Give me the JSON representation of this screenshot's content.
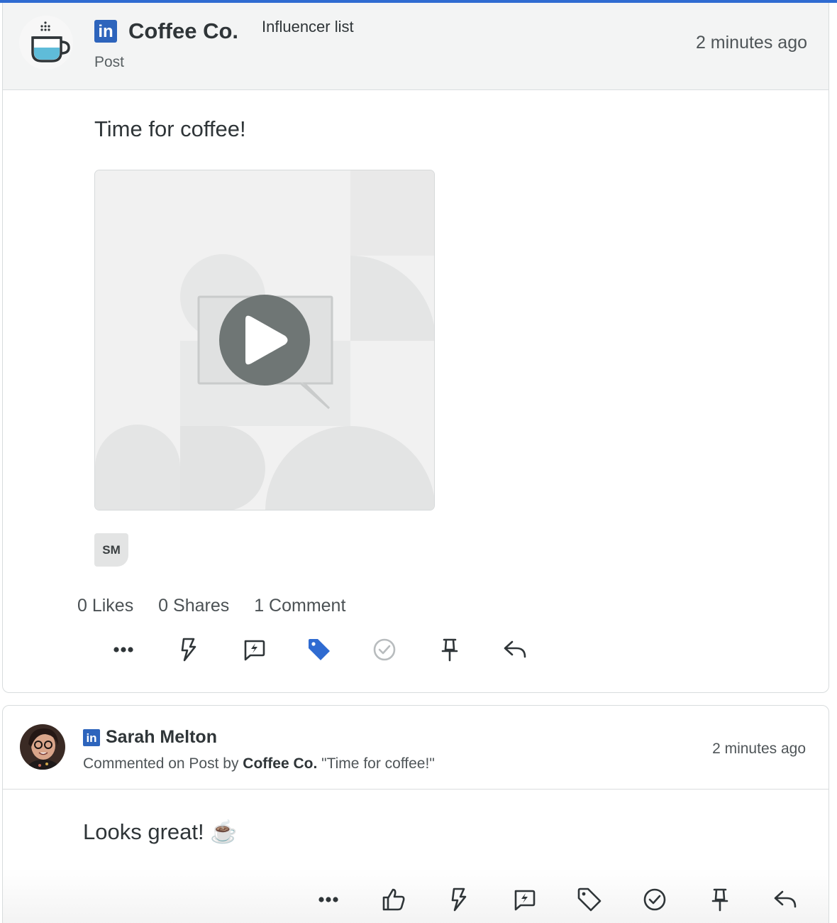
{
  "colors": {
    "accent": "#2f6bd1",
    "linkedin": "#2d64bc",
    "tag_active": "#2f6bd1",
    "check_muted": "#b8bcbe",
    "play_button": "#6f7675"
  },
  "post": {
    "author": "Coffee Co.",
    "network_badge": "in",
    "list_label": "Influencer list",
    "type": "Post",
    "time": "2 minutes ago",
    "text": "Time for coffee!",
    "media": {
      "kind": "video",
      "icon": "play-icon"
    },
    "assignee_initials": "SM",
    "stats": {
      "likes": "0 Likes",
      "shares": "0 Shares",
      "comments": "1 Comment"
    },
    "actions": [
      {
        "name": "more-icon",
        "state": "default"
      },
      {
        "name": "lightning-icon",
        "state": "default"
      },
      {
        "name": "quick-reply-icon",
        "state": "default"
      },
      {
        "name": "tag-icon",
        "state": "active"
      },
      {
        "name": "complete-check-icon",
        "state": "muted"
      },
      {
        "name": "pin-icon",
        "state": "default"
      },
      {
        "name": "reply-icon",
        "state": "default"
      }
    ]
  },
  "comment": {
    "author": "Sarah Melton",
    "network_badge": "in",
    "meta_prefix": "Commented on Post by",
    "meta_author": "Coffee Co.",
    "meta_quote": "\"Time for coffee!\"",
    "time": "2 minutes ago",
    "text": "Looks great! ☕",
    "actions": [
      {
        "name": "more-icon"
      },
      {
        "name": "like-icon"
      },
      {
        "name": "lightning-icon"
      },
      {
        "name": "quick-reply-icon"
      },
      {
        "name": "tag-icon"
      },
      {
        "name": "complete-check-icon"
      },
      {
        "name": "pin-icon"
      },
      {
        "name": "reply-icon"
      }
    ]
  }
}
